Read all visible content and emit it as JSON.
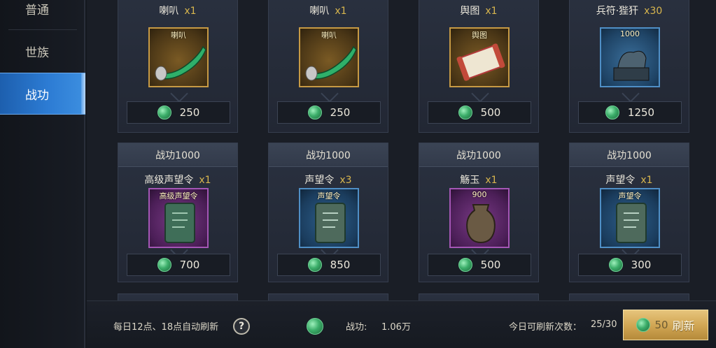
{
  "sidebar": {
    "tabs": [
      {
        "label": "普通",
        "active": false
      },
      {
        "label": "世族",
        "active": false
      },
      {
        "label": "战功",
        "active": true
      }
    ]
  },
  "shop": {
    "row1": [
      {
        "name": "喇叭",
        "qty": "x1",
        "icon": "horn-icon",
        "frame": "gold",
        "tag": "喇叭",
        "price": "250"
      },
      {
        "name": "喇叭",
        "qty": "x1",
        "icon": "horn-icon",
        "frame": "gold",
        "tag": "喇叭",
        "price": "250"
      },
      {
        "name": "舆图",
        "qty": "x1",
        "icon": "map-scroll-icon",
        "frame": "gold",
        "tag": "舆图",
        "price": "500"
      },
      {
        "name": "兵符·狴犴",
        "qty": "x30",
        "icon": "tiger-tally-icon",
        "frame": "blue",
        "tag": "1000",
        "price": "1250"
      }
    ],
    "row2": [
      {
        "requirement": "战功1000",
        "name": "高级声望令",
        "qty": "x1",
        "icon": "prestige-token-icon",
        "frame": "purple",
        "tag": "高级声望令",
        "price": "700"
      },
      {
        "requirement": "战功1000",
        "name": "声望令",
        "qty": "x3",
        "icon": "prestige-token-icon",
        "frame": "blue",
        "tag": "声望令",
        "price": "850"
      },
      {
        "requirement": "战功1000",
        "name": "觞玉",
        "qty": "x1",
        "icon": "jade-vase-icon",
        "frame": "purple",
        "tag": "900",
        "price": "500"
      },
      {
        "requirement": "战功1000",
        "name": "声望令",
        "qty": "x1",
        "icon": "prestige-token-icon",
        "frame": "blue",
        "tag": "声望令",
        "price": "300"
      }
    ]
  },
  "footer": {
    "auto_refresh_note": "每日12点、18点自动刷新",
    "help_label": "?",
    "merit_label": "战功:",
    "merit_value": "1.06万",
    "refresh_count_label": "今日可刷新次数：",
    "refresh_count_value": "25/30",
    "refresh_cost": "50",
    "refresh_label": "刷新"
  },
  "colors": {
    "active_tab": "#2c7bd3",
    "qty": "#d8b64e",
    "jade_currency": "#3cae6a",
    "refresh_button": "#cfa452"
  }
}
